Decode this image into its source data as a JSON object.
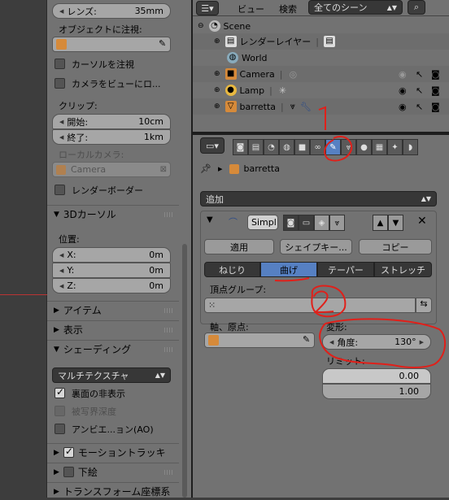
{
  "left": {
    "lens": {
      "label": "レンズ:",
      "value": "35mm"
    },
    "object_target_label": "オブジェクトに注視:",
    "track_cursor": "カーソルを注視",
    "camera_to_view": "カメラをビューにロ...",
    "clip_label": "クリップ:",
    "clip_start": {
      "label": "開始:",
      "value": "10cm"
    },
    "clip_end": {
      "label": "終了:",
      "value": "1km"
    },
    "local_camera_label": "ローカルカメラ:",
    "local_camera_value": "Camera",
    "render_border": "レンダーボーダー",
    "cursor_section": "3Dカーソル",
    "position_label": "位置:",
    "x": {
      "label": "X:",
      "value": "0m"
    },
    "y": {
      "label": "Y:",
      "value": "0m"
    },
    "z": {
      "label": "Z:",
      "value": "0m"
    },
    "item_section": "アイテム",
    "display_section": "表示",
    "shading_section": "シェーディング",
    "shading_mode": "マルチテクスチャ",
    "backface_culling": "裏面の非表示",
    "dof": "被写界深度",
    "ao": "アンビエ...ョン(AO)",
    "motion_tracking": "モーショントラッキ",
    "background_images": "下絵",
    "transform_orientation": "トランスフォーム座標系"
  },
  "outliner": {
    "menu_view": "ビュー",
    "menu_search": "検索",
    "scene_filter": "全てのシーン",
    "rows": [
      {
        "name": "Scene"
      },
      {
        "name": "レンダーレイヤー"
      },
      {
        "name": "World"
      },
      {
        "name": "Camera"
      },
      {
        "name": "Lamp"
      },
      {
        "name": "barretta"
      }
    ]
  },
  "properties": {
    "breadcrumb_object": "barretta",
    "add_modifier": "追加",
    "modifier_name": "Simpl",
    "apply_button": "適用",
    "shapekey_button": "シェイプキー...",
    "copy_button": "コピー",
    "modes": [
      "ねじり",
      "曲げ",
      "テーパー",
      "ストレッチ"
    ],
    "active_mode": "曲げ",
    "vertex_group_label": "頂点グループ:",
    "origin_label": "軸、原点:",
    "deform_label": "変形:",
    "angle": {
      "label": "角度:",
      "value": "130°"
    },
    "limits_label": "リミット:",
    "limit_min": "0.00",
    "limit_max": "1.00"
  },
  "annotations": {
    "one": "1",
    "two": "2"
  },
  "colors": {
    "accent": "#5680c2",
    "scribble": "#e0201a"
  }
}
